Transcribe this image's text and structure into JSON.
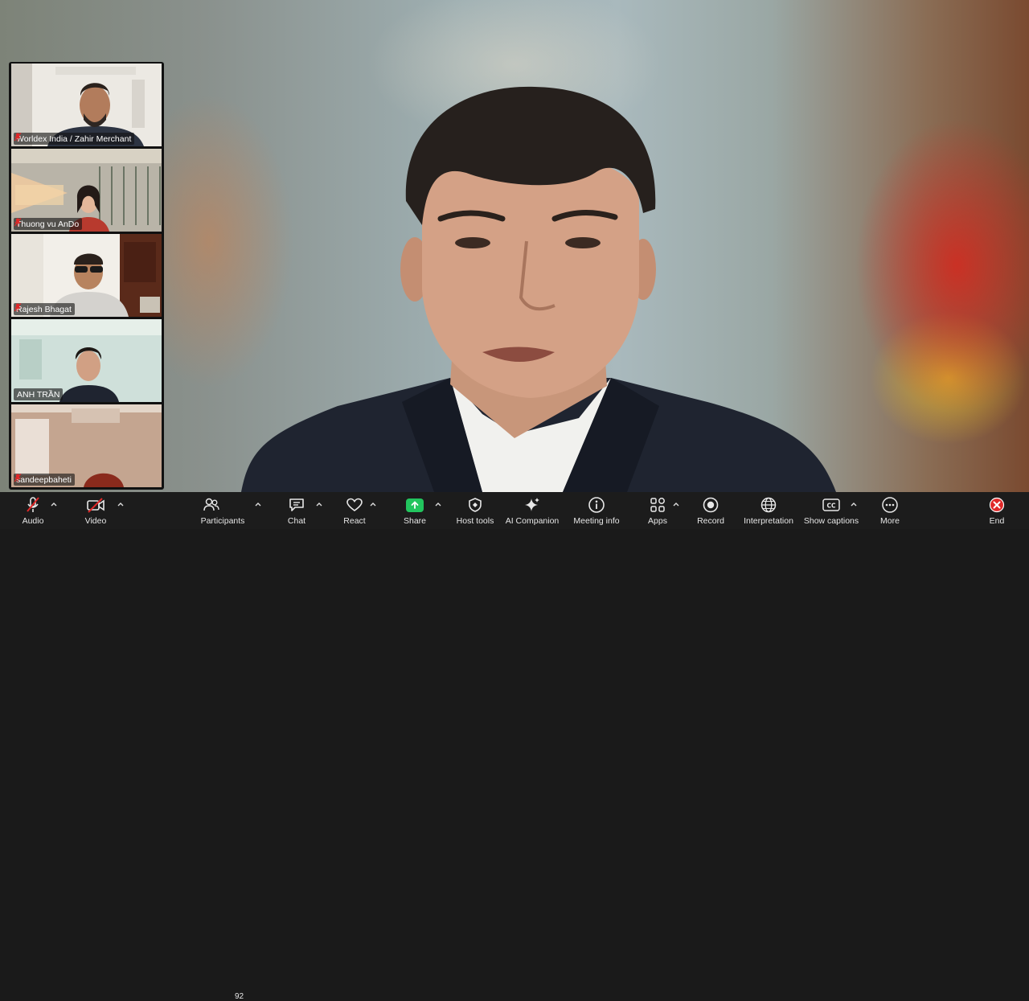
{
  "participants_gallery": [
    {
      "name": "Worldex India / Zahir Merchant",
      "muted": true
    },
    {
      "name": "Thuong vu AnDo",
      "muted": true
    },
    {
      "name": "Rajesh Bhagat",
      "muted": true
    },
    {
      "name": "ANH TRẦN",
      "muted": false
    },
    {
      "name": "sandeepbaheti",
      "muted": true
    }
  ],
  "toolbar": {
    "audio_label": "Audio",
    "video_label": "Video",
    "participants_label": "Participants",
    "participants_count": "92",
    "chat_label": "Chat",
    "react_label": "React",
    "share_label": "Share",
    "host_tools_label": "Host tools",
    "ai_companion_label": "AI Companion",
    "meeting_info_label": "Meeting info",
    "apps_label": "Apps",
    "record_label": "Record",
    "interpretation_label": "Interpretation",
    "show_captions_label": "Show captions",
    "more_label": "More",
    "end_label": "End"
  },
  "colors": {
    "toolbar_bg": "#1c1c1c",
    "share_accent": "#22c55e",
    "end_accent": "#e02828",
    "mute_red": "#e02828"
  }
}
